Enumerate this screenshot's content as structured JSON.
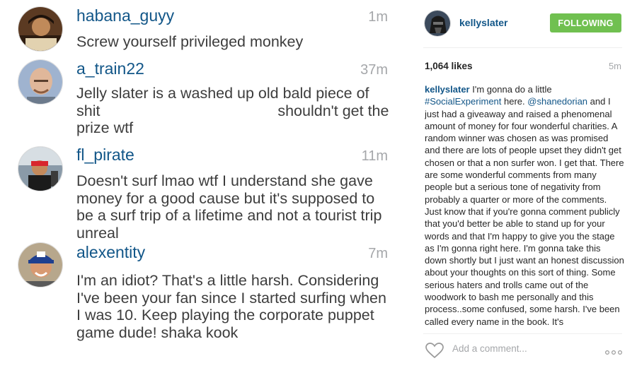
{
  "comments": [
    {
      "username": "habana_guyy",
      "time": "1m",
      "avatar_icon": "user-avatar-icon",
      "text": "Screw yourself privileged monkey"
    },
    {
      "username": "a_train22",
      "time": "37m",
      "avatar_icon": "user-avatar-icon",
      "text": "Jelly slater is a washed up old bald piece of shit                                          shouldn't get the prize wtf"
    },
    {
      "username": "fl_pirate",
      "time": "11m",
      "avatar_icon": "user-avatar-icon",
      "text": "Doesn't surf lmao wtf I understand she gave money for a good cause but it's supposed to be a surf trip of a lifetime and not a tourist trip unreal"
    },
    {
      "username": "alexentity",
      "time": "7m",
      "avatar_icon": "user-avatar-icon",
      "text": "I'm an idiot? That's a little harsh. Considering I've been your fan since I started surfing when I was 10. Keep playing the corporate puppet game dude! shaka kook"
    }
  ],
  "post": {
    "author": "kellyslater",
    "follow_label": "FOLLOWING",
    "likes": "1,064 likes",
    "age": "5m",
    "caption": {
      "author": "kellyslater",
      "part1": "I'm gonna do a little",
      "hashtag": "#SocialExperiment",
      "part2": "here.",
      "mention": "@shanedorian",
      "part3": "and I just had a giveaway and raised a phenomenal amount of money for four wonderful charities. A random winner was chosen as was promised and there are lots of people upset they didn't get chosen or that a non surfer won. I get that. There are some wonderful comments from many people but a serious tone of negativity from probably a quarter or more of the comments. Just know that if you're gonna comment publicly that you'd better be able to stand up for your words and that I'm happy to give you the stage as I'm gonna right here. I'm gonna take this down shortly but I just want an honest discussion about your thoughts on this sort of thing. Some serious haters and trolls came out of the woodwork to bash me personally and this process..some confused, some harsh. I've been called every name in the book. It's"
    },
    "add_comment_placeholder": "Add a comment...",
    "icons": {
      "heart": "heart-icon",
      "more": "more-options-icon"
    }
  },
  "colors": {
    "link": "#125688",
    "follow_green": "#70c050",
    "muted": "#a5a7aa",
    "text": "#3d3d3d"
  }
}
